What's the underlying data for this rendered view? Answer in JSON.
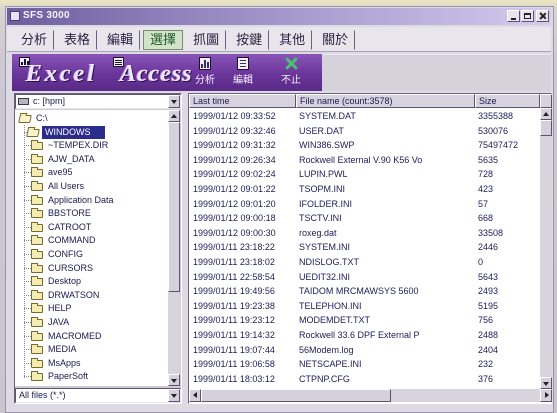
{
  "window": {
    "title": "SFS 3000"
  },
  "menu": {
    "tabs": [
      "分析",
      "表格",
      "編輯",
      "選擇",
      "抓圖",
      "按鍵",
      "其他",
      "關於"
    ],
    "active_index": 3
  },
  "toolbar": {
    "logo_left": "Excel",
    "logo_right": "Access",
    "buttons": [
      {
        "label": "分析",
        "icon": "analyze-icon"
      },
      {
        "label": "編輯",
        "icon": "edit-icon"
      },
      {
        "label": "不止",
        "icon": "stop-icon"
      }
    ]
  },
  "left_panel": {
    "drive": "c: [hpm]",
    "tree": [
      {
        "label": "C:\\",
        "level": 0,
        "open": true
      },
      {
        "label": "WINDOWS",
        "level": 1,
        "open": true,
        "selected": true
      },
      {
        "label": "~TEMPEX.DIR",
        "level": 2
      },
      {
        "label": "AJW_DATA",
        "level": 2
      },
      {
        "label": "ave95",
        "level": 2
      },
      {
        "label": "All Users",
        "level": 2
      },
      {
        "label": "Application Data",
        "level": 2
      },
      {
        "label": "BBSTORE",
        "level": 2
      },
      {
        "label": "CATROOT",
        "level": 2
      },
      {
        "label": "COMMAND",
        "level": 2
      },
      {
        "label": "CONFIG",
        "level": 2
      },
      {
        "label": "CURSORS",
        "level": 2
      },
      {
        "label": "Desktop",
        "level": 2
      },
      {
        "label": "DRWATSON",
        "level": 2
      },
      {
        "label": "HELP",
        "level": 2
      },
      {
        "label": "JAVA",
        "level": 2
      },
      {
        "label": "MACROMED",
        "level": 2
      },
      {
        "label": "MEDIA",
        "level": 2
      },
      {
        "label": "MsApps",
        "level": 2
      },
      {
        "label": "PaperSoft",
        "level": 2
      }
    ],
    "filter": "All files (*.*)"
  },
  "file_list": {
    "columns": {
      "time": "Last time",
      "name": "File name (count:3578)",
      "size": "Size"
    },
    "rows": [
      {
        "time": "1999/01/12 09:33:52",
        "name": "SYSTEM.DAT",
        "size": "3355388"
      },
      {
        "time": "1999/01/12 09:32:46",
        "name": "USER.DAT",
        "size": "530076"
      },
      {
        "time": "1999/01/12 09:31:32",
        "name": "WIN386.SWP",
        "size": "75497472"
      },
      {
        "time": "1999/01/12 09:26:34",
        "name": "Rockwell External V.90 K56 Vo",
        "size": "5635"
      },
      {
        "time": "1999/01/12 09:02:24",
        "name": "LUPIN.PWL",
        "size": "728"
      },
      {
        "time": "1999/01/12 09:01:22",
        "name": "TSOPM.INI",
        "size": "423"
      },
      {
        "time": "1999/01/12 09:01:20",
        "name": "IFOLDER.INI",
        "size": "57"
      },
      {
        "time": "1999/01/12 09:00:18",
        "name": "TSCTV.INI",
        "size": "668"
      },
      {
        "time": "1999/01/12 09:00:30",
        "name": "roxeg.dat",
        "size": "33508"
      },
      {
        "time": "1999/01/11 23:18:22",
        "name": "SYSTEM.INI",
        "size": "2446"
      },
      {
        "time": "1999/01/11 23:18:02",
        "name": "NDISLOG.TXT",
        "size": "0"
      },
      {
        "time": "1999/01/11 22:58:54",
        "name": "UEDIT32.INI",
        "size": "5643"
      },
      {
        "time": "1999/01/11 19:49:56",
        "name": "TAIDOM MRCMAWSYS 5600",
        "size": "2493"
      },
      {
        "time": "1999/01/11 19:23:38",
        "name": "TELEPHON.INI",
        "size": "5195"
      },
      {
        "time": "1999/01/11 19:23:12",
        "name": "MODEMDET.TXT",
        "size": "756"
      },
      {
        "time": "1999/01/11 19:14:32",
        "name": "Rockwell 33.6 DPF External P",
        "size": "2488"
      },
      {
        "time": "1999/01/11 19:07:44",
        "name": "56Modem.log",
        "size": "2404"
      },
      {
        "time": "1999/01/11 19:06:58",
        "name": "NETSCAPE.INI",
        "size": "232"
      },
      {
        "time": "1999/01/11 18:03:12",
        "name": "CTPNP.CFG",
        "size": "376"
      }
    ]
  },
  "colors": {
    "title_bar": "#6e5e9e",
    "toolbar": "#6a3598",
    "selection": "#2c2c8c",
    "active_tab": "#d2e4c8",
    "stop_icon": "#4cc070"
  }
}
